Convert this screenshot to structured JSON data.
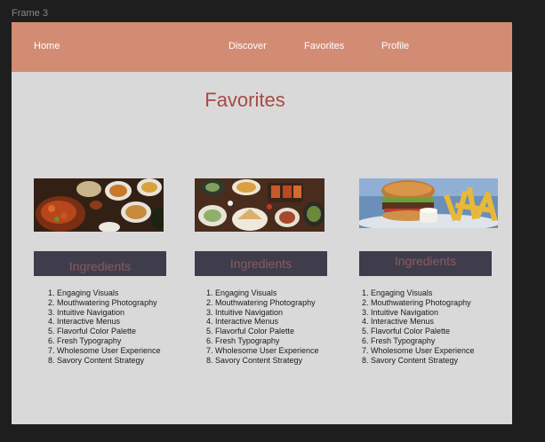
{
  "frame": {
    "label": "Frame 3"
  },
  "nav": {
    "home": "Home",
    "discover": "Discover",
    "favorites": "Favorites",
    "profile": "Profile",
    "color": "#d38c74"
  },
  "page": {
    "title": "Favorites"
  },
  "cards": [
    {
      "image_icon": "curry-dishes-photo",
      "ingredients_label": "Ingredients",
      "items": [
        "1. Engaging Visuals",
        "2. Mouthwatering Photography",
        "3. Intuitive Navigation",
        "4. Interactive Menus",
        "5. Flavorful Color Palette",
        "6. Fresh Typography",
        "7. Wholesome User Experience",
        "8. Savory Content Strategy"
      ]
    },
    {
      "image_icon": "table-spread-photo",
      "ingredients_label": "Ingredients",
      "items": [
        "1. Engaging Visuals",
        "2. Mouthwatering Photography",
        "3. Intuitive Navigation",
        "4. Interactive Menus",
        "5. Flavorful Color Palette",
        "6. Fresh Typography",
        "7. Wholesome User Experience",
        "8. Savory Content Strategy"
      ]
    },
    {
      "image_icon": "burger-fries-photo",
      "ingredients_label": "Ingredients",
      "items": [
        "1. Engaging Visuals",
        "2. Mouthwatering Photography",
        "3. Intuitive Navigation",
        "4. Interactive Menus",
        "5. Flavorful Color Palette",
        "6. Fresh Typography",
        "7. Wholesome User Experience",
        "8. Savory Content Strategy"
      ]
    }
  ]
}
